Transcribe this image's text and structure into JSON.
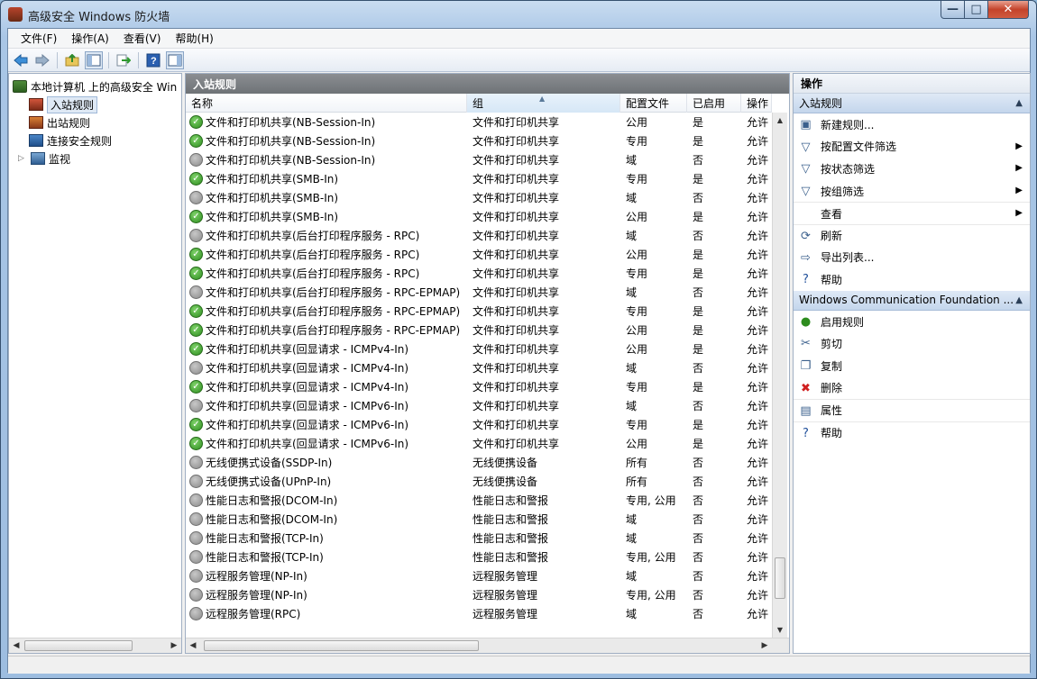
{
  "window": {
    "title": "高级安全 Windows 防火墙",
    "min_glyph": "—",
    "max_glyph": "□",
    "close_glyph": "✕"
  },
  "menu": [
    "文件(F)",
    "操作(A)",
    "查看(V)",
    "帮助(H)"
  ],
  "toolbar": [
    "back-icon",
    "forward-icon",
    "up-folder-icon",
    "show-hide-tree-icon",
    "export-icon",
    "help-icon",
    "show-hide-action-pane-icon"
  ],
  "tree": {
    "root": "本地计算机 上的高级安全 Win",
    "items": [
      "入站规则",
      "出站规则",
      "连接安全规则",
      "监视"
    ],
    "expander": "▷"
  },
  "center": {
    "header": "入站规则",
    "columns": [
      "名称",
      "组",
      "配置文件",
      "已启用",
      "操作"
    ],
    "rows": [
      {
        "name": "文件和打印机共享(NB-Session-In)",
        "group": "文件和打印机共享",
        "profile": "公用",
        "enabled": "是",
        "action": "允许",
        "on": true
      },
      {
        "name": "文件和打印机共享(NB-Session-In)",
        "group": "文件和打印机共享",
        "profile": "专用",
        "enabled": "是",
        "action": "允许",
        "on": true
      },
      {
        "name": "文件和打印机共享(NB-Session-In)",
        "group": "文件和打印机共享",
        "profile": "域",
        "enabled": "否",
        "action": "允许",
        "on": false
      },
      {
        "name": "文件和打印机共享(SMB-In)",
        "group": "文件和打印机共享",
        "profile": "专用",
        "enabled": "是",
        "action": "允许",
        "on": true
      },
      {
        "name": "文件和打印机共享(SMB-In)",
        "group": "文件和打印机共享",
        "profile": "域",
        "enabled": "否",
        "action": "允许",
        "on": false
      },
      {
        "name": "文件和打印机共享(SMB-In)",
        "group": "文件和打印机共享",
        "profile": "公用",
        "enabled": "是",
        "action": "允许",
        "on": true
      },
      {
        "name": "文件和打印机共享(后台打印程序服务 - RPC)",
        "group": "文件和打印机共享",
        "profile": "域",
        "enabled": "否",
        "action": "允许",
        "on": false
      },
      {
        "name": "文件和打印机共享(后台打印程序服务 - RPC)",
        "group": "文件和打印机共享",
        "profile": "公用",
        "enabled": "是",
        "action": "允许",
        "on": true
      },
      {
        "name": "文件和打印机共享(后台打印程序服务 - RPC)",
        "group": "文件和打印机共享",
        "profile": "专用",
        "enabled": "是",
        "action": "允许",
        "on": true
      },
      {
        "name": "文件和打印机共享(后台打印程序服务 - RPC-EPMAP)",
        "group": "文件和打印机共享",
        "profile": "域",
        "enabled": "否",
        "action": "允许",
        "on": false
      },
      {
        "name": "文件和打印机共享(后台打印程序服务 - RPC-EPMAP)",
        "group": "文件和打印机共享",
        "profile": "专用",
        "enabled": "是",
        "action": "允许",
        "on": true
      },
      {
        "name": "文件和打印机共享(后台打印程序服务 - RPC-EPMAP)",
        "group": "文件和打印机共享",
        "profile": "公用",
        "enabled": "是",
        "action": "允许",
        "on": true
      },
      {
        "name": "文件和打印机共享(回显请求 - ICMPv4-In)",
        "group": "文件和打印机共享",
        "profile": "公用",
        "enabled": "是",
        "action": "允许",
        "on": true
      },
      {
        "name": "文件和打印机共享(回显请求 - ICMPv4-In)",
        "group": "文件和打印机共享",
        "profile": "域",
        "enabled": "否",
        "action": "允许",
        "on": false
      },
      {
        "name": "文件和打印机共享(回显请求 - ICMPv4-In)",
        "group": "文件和打印机共享",
        "profile": "专用",
        "enabled": "是",
        "action": "允许",
        "on": true
      },
      {
        "name": "文件和打印机共享(回显请求 - ICMPv6-In)",
        "group": "文件和打印机共享",
        "profile": "域",
        "enabled": "否",
        "action": "允许",
        "on": false
      },
      {
        "name": "文件和打印机共享(回显请求 - ICMPv6-In)",
        "group": "文件和打印机共享",
        "profile": "专用",
        "enabled": "是",
        "action": "允许",
        "on": true
      },
      {
        "name": "文件和打印机共享(回显请求 - ICMPv6-In)",
        "group": "文件和打印机共享",
        "profile": "公用",
        "enabled": "是",
        "action": "允许",
        "on": true
      },
      {
        "name": "无线便携式设备(SSDP-In)",
        "group": "无线便携设备",
        "profile": "所有",
        "enabled": "否",
        "action": "允许",
        "on": false
      },
      {
        "name": "无线便携式设备(UPnP-In)",
        "group": "无线便携设备",
        "profile": "所有",
        "enabled": "否",
        "action": "允许",
        "on": false
      },
      {
        "name": "性能日志和警报(DCOM-In)",
        "group": "性能日志和警报",
        "profile": "专用, 公用",
        "enabled": "否",
        "action": "允许",
        "on": false
      },
      {
        "name": "性能日志和警报(DCOM-In)",
        "group": "性能日志和警报",
        "profile": "域",
        "enabled": "否",
        "action": "允许",
        "on": false
      },
      {
        "name": "性能日志和警报(TCP-In)",
        "group": "性能日志和警报",
        "profile": "域",
        "enabled": "否",
        "action": "允许",
        "on": false
      },
      {
        "name": "性能日志和警报(TCP-In)",
        "group": "性能日志和警报",
        "profile": "专用, 公用",
        "enabled": "否",
        "action": "允许",
        "on": false
      },
      {
        "name": "远程服务管理(NP-In)",
        "group": "远程服务管理",
        "profile": "域",
        "enabled": "否",
        "action": "允许",
        "on": false
      },
      {
        "name": "远程服务管理(NP-In)",
        "group": "远程服务管理",
        "profile": "专用, 公用",
        "enabled": "否",
        "action": "允许",
        "on": false
      },
      {
        "name": "远程服务管理(RPC)",
        "group": "远程服务管理",
        "profile": "域",
        "enabled": "否",
        "action": "允许",
        "on": false
      }
    ]
  },
  "actions": {
    "header": "操作",
    "section1": {
      "title": "入站规则",
      "items": [
        {
          "label": "新建规则...",
          "icon": "new-rule-icon",
          "glyph": "▣",
          "submenu": false
        },
        {
          "label": "按配置文件筛选",
          "icon": "filter-icon",
          "glyph": "▽",
          "submenu": true
        },
        {
          "label": "按状态筛选",
          "icon": "filter-icon",
          "glyph": "▽",
          "submenu": true
        },
        {
          "label": "按组筛选",
          "icon": "filter-icon",
          "glyph": "▽",
          "submenu": true
        },
        {
          "label": "查看",
          "icon": "",
          "glyph": "",
          "submenu": true
        },
        {
          "label": "刷新",
          "icon": "refresh-icon",
          "glyph": "⟳",
          "submenu": false
        },
        {
          "label": "导出列表...",
          "icon": "export-icon",
          "glyph": "⇨",
          "submenu": false
        },
        {
          "label": "帮助",
          "icon": "help-icon",
          "glyph": "?",
          "submenu": false
        }
      ]
    },
    "section2": {
      "title": "Windows Communication Foundation ...",
      "items": [
        {
          "label": "启用规则",
          "icon": "enable-rule-icon",
          "glyph": "●",
          "submenu": false
        },
        {
          "label": "剪切",
          "icon": "cut-icon",
          "glyph": "✂",
          "submenu": false
        },
        {
          "label": "复制",
          "icon": "copy-icon",
          "glyph": "❐",
          "submenu": false
        },
        {
          "label": "删除",
          "icon": "delete-icon",
          "glyph": "✖",
          "submenu": false
        },
        {
          "label": "属性",
          "icon": "properties-icon",
          "glyph": "▤",
          "submenu": false
        },
        {
          "label": "帮助",
          "icon": "help-icon",
          "glyph": "?",
          "submenu": false
        }
      ]
    }
  },
  "colors": {
    "enabled": "#2d8c1e",
    "disabled": "#8a8a8a",
    "delete": "#d02020",
    "help": "#1f4f9a"
  }
}
